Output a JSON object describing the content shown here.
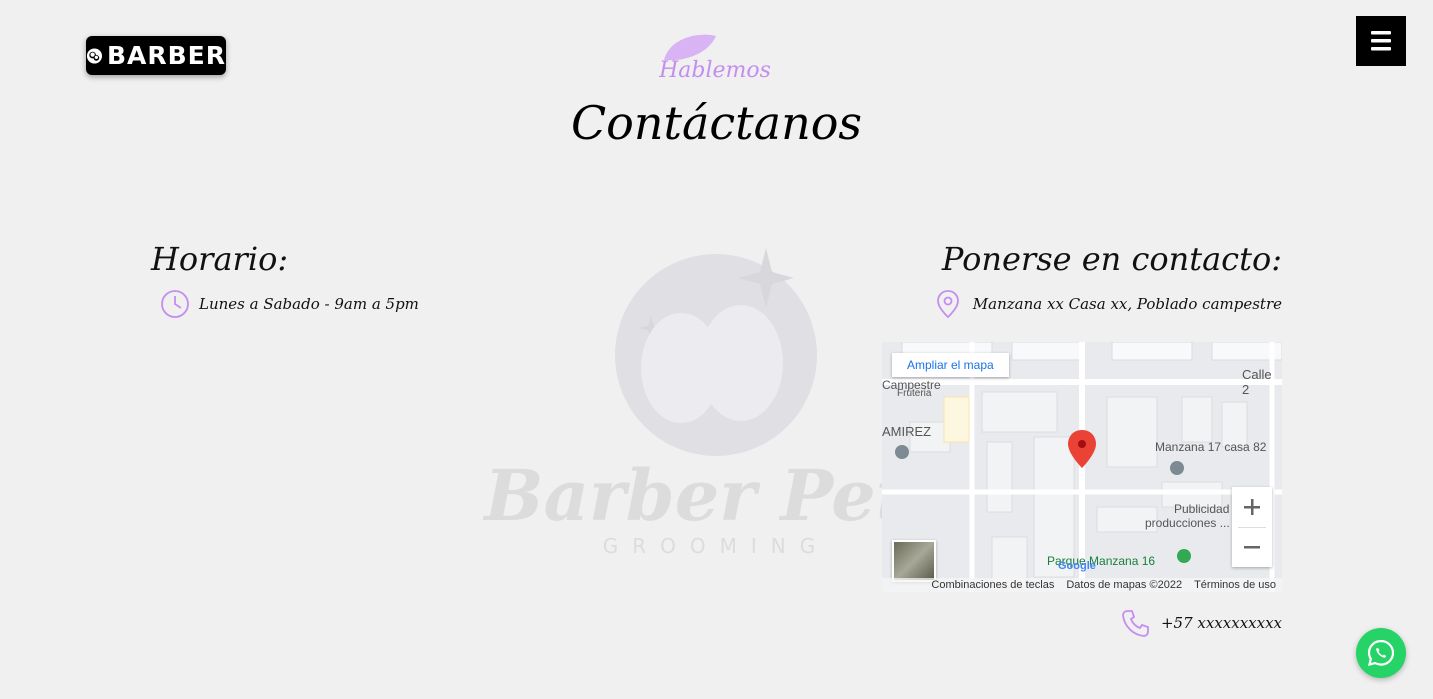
{
  "header": {
    "logo_text": "BARBER",
    "menu_icon": "bars-icon"
  },
  "section": {
    "eyebrow": "Hablemos",
    "title": "Contáctanos"
  },
  "watermark": {
    "brand": "Barber Pets",
    "tagline": "GROOMING"
  },
  "schedule": {
    "heading": "Horario:",
    "hours": "Lunes a Sabado - 9am a 5pm",
    "icon": "clock-icon"
  },
  "contact": {
    "heading": "Ponerse en contacto:",
    "address": "Manzana xx Casa xx, Poblado campestre",
    "phone": "+57 xxxxxxxxxx",
    "address_icon": "map-pin-icon",
    "phone_icon": "phone-icon"
  },
  "map": {
    "expand_label": "Ampliar el mapa",
    "labels": {
      "street": "Calle 2",
      "store": "Campestre",
      "store_sub": "Fruteria",
      "district": "AMIREZ",
      "place": "Manzana 17 casa 82",
      "business": "Publicidad y",
      "business_sub": "producciones ...",
      "park": "Parque Manzana 16"
    },
    "footer": {
      "shortcuts": "Combinaciones de teclas",
      "data": "Datos de mapas ©2022",
      "terms": "Términos de uso"
    },
    "google": "Google"
  },
  "colors": {
    "accent": "#c48ef0",
    "background": "#f0f0f0",
    "whatsapp": "#25d366"
  }
}
